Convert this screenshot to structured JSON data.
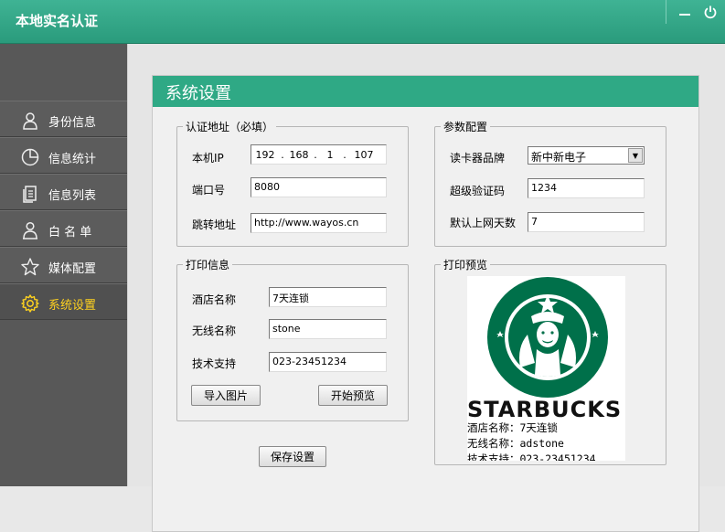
{
  "window": {
    "title": "本地实名认证"
  },
  "sidebar": {
    "items": [
      {
        "label": "身份信息",
        "icon": "person-icon"
      },
      {
        "label": "信息统计",
        "icon": "pie-chart-icon"
      },
      {
        "label": "信息列表",
        "icon": "document-list-icon"
      },
      {
        "label": "白 名 单",
        "icon": "user-whitelist-icon"
      },
      {
        "label": "媒体配置",
        "icon": "star-icon"
      },
      {
        "label": "系统设置",
        "icon": "gear-icon",
        "active": true
      }
    ]
  },
  "panel": {
    "title": "系统设置"
  },
  "auth": {
    "legend": "认证地址（必填）",
    "ip_label": "本机IP",
    "ip_parts": [
      "192",
      "168",
      "1",
      "107"
    ],
    "port_label": "端口号",
    "port_value": "8080",
    "redirect_label": "跳转地址",
    "redirect_value": "http://www.wayos.cn"
  },
  "params": {
    "legend": "参数配置",
    "brand_label": "读卡器品牌",
    "brand_value": "新中新电子",
    "super_code_label": "超级验证码",
    "super_code_value": "1234",
    "days_label": "默认上网天数",
    "days_value": "7"
  },
  "print": {
    "legend": "打印信息",
    "hotel_label": "酒店名称",
    "hotel_value": "7天连锁",
    "wifi_label": "无线名称",
    "wifi_value": "stone",
    "support_label": "技术支持",
    "support_value": "023-23451234",
    "import_button": "导入图片",
    "preview_button": "开始预览"
  },
  "print_preview": {
    "legend": "打印预览",
    "brand_text": "STARBUCKS",
    "lines": [
      "酒店名称：7天连锁",
      "无线名称：adstone",
      "技术支持：023-23451234"
    ]
  },
  "save_button": "保存设置",
  "colors": {
    "accent": "#2fa985",
    "sidebar": "#585858",
    "active_nav": "#ffd21f",
    "logo_green": "#00704a"
  }
}
